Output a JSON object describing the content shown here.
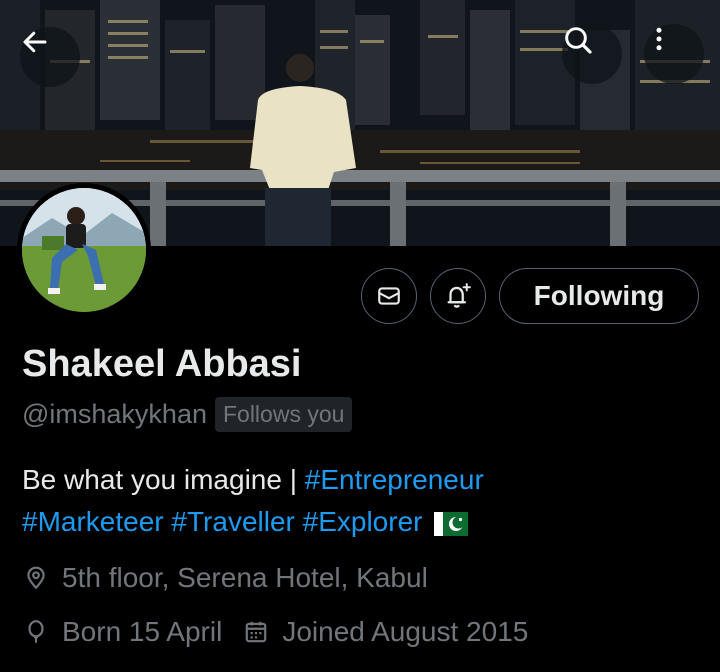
{
  "header": {
    "back_icon": "arrow-left-icon",
    "search_icon": "search-icon",
    "more_icon": "more-vertical-icon"
  },
  "profile": {
    "name": "Shakeel Abbasi",
    "handle": "@imshakykhan",
    "follows_you": "Follows you",
    "bio_text": "Be what you imagine | ",
    "bio_tags_line1": [
      "#Entrepreneur"
    ],
    "bio_tags_line2": [
      "#Marketeer",
      "#Traveller",
      "#Explorer"
    ],
    "bio_flag": "pakistan-flag",
    "location": "5th floor, Serena Hotel, Kabul",
    "birth": "Born 15 April",
    "joined": "Joined August 2015"
  },
  "actions": {
    "following_label": "Following",
    "message_icon": "mail-icon",
    "notify_icon": "bell-plus-icon"
  },
  "colors": {
    "background": "#000000",
    "text": "#e7e9ea",
    "muted": "#71767b",
    "link": "#1d9bf0",
    "border": "#536471"
  }
}
